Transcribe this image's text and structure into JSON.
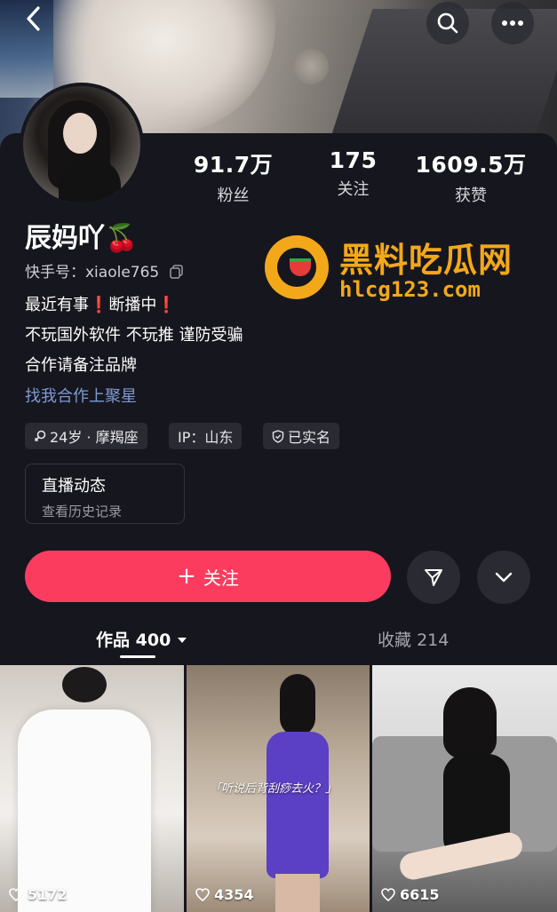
{
  "profile": {
    "name": "辰妈吖🍒",
    "uid_label": "快手号：",
    "uid_value": "xiaole765",
    "bio": [
      "最近有事❗断播中❗",
      "不玩国外软件 不玩推  谨防受骗",
      "合作请备注品牌"
    ],
    "link_text": "找我合作上聚星"
  },
  "stats": [
    {
      "value": "91.7万",
      "label": "粉丝"
    },
    {
      "value": "175",
      "label": "关注"
    },
    {
      "value": "1609.5万",
      "label": "获赞"
    }
  ],
  "tags": {
    "age": "24岁 · 摩羯座",
    "ip": "IP：山东",
    "verified": "已实名"
  },
  "live_card": {
    "title": "直播动态",
    "subtitle": "查看历史记录"
  },
  "actions": {
    "follow_label": "关注",
    "follow_icon": "+"
  },
  "tabs": {
    "works": "作品",
    "works_count": "400",
    "favorites": "收藏",
    "favorites_count": "214"
  },
  "watermark": {
    "title": "黑料吃瓜网",
    "url": "hlcg123.com"
  },
  "videos": [
    {
      "likes": "5172"
    },
    {
      "likes": "4354",
      "caption": "「听说后背刮痧去火？」"
    },
    {
      "likes": "6615"
    }
  ],
  "colors": {
    "background": "#16161e",
    "follow_button": "#fb3c5e",
    "link": "#7d9ad1",
    "watermark": "#f3a81a"
  },
  "icons": [
    "back-icon",
    "search-icon",
    "more-icon",
    "send-icon",
    "chevron-down-icon",
    "heart-icon",
    "copy-icon",
    "shield-icon",
    "gender-icon"
  ]
}
